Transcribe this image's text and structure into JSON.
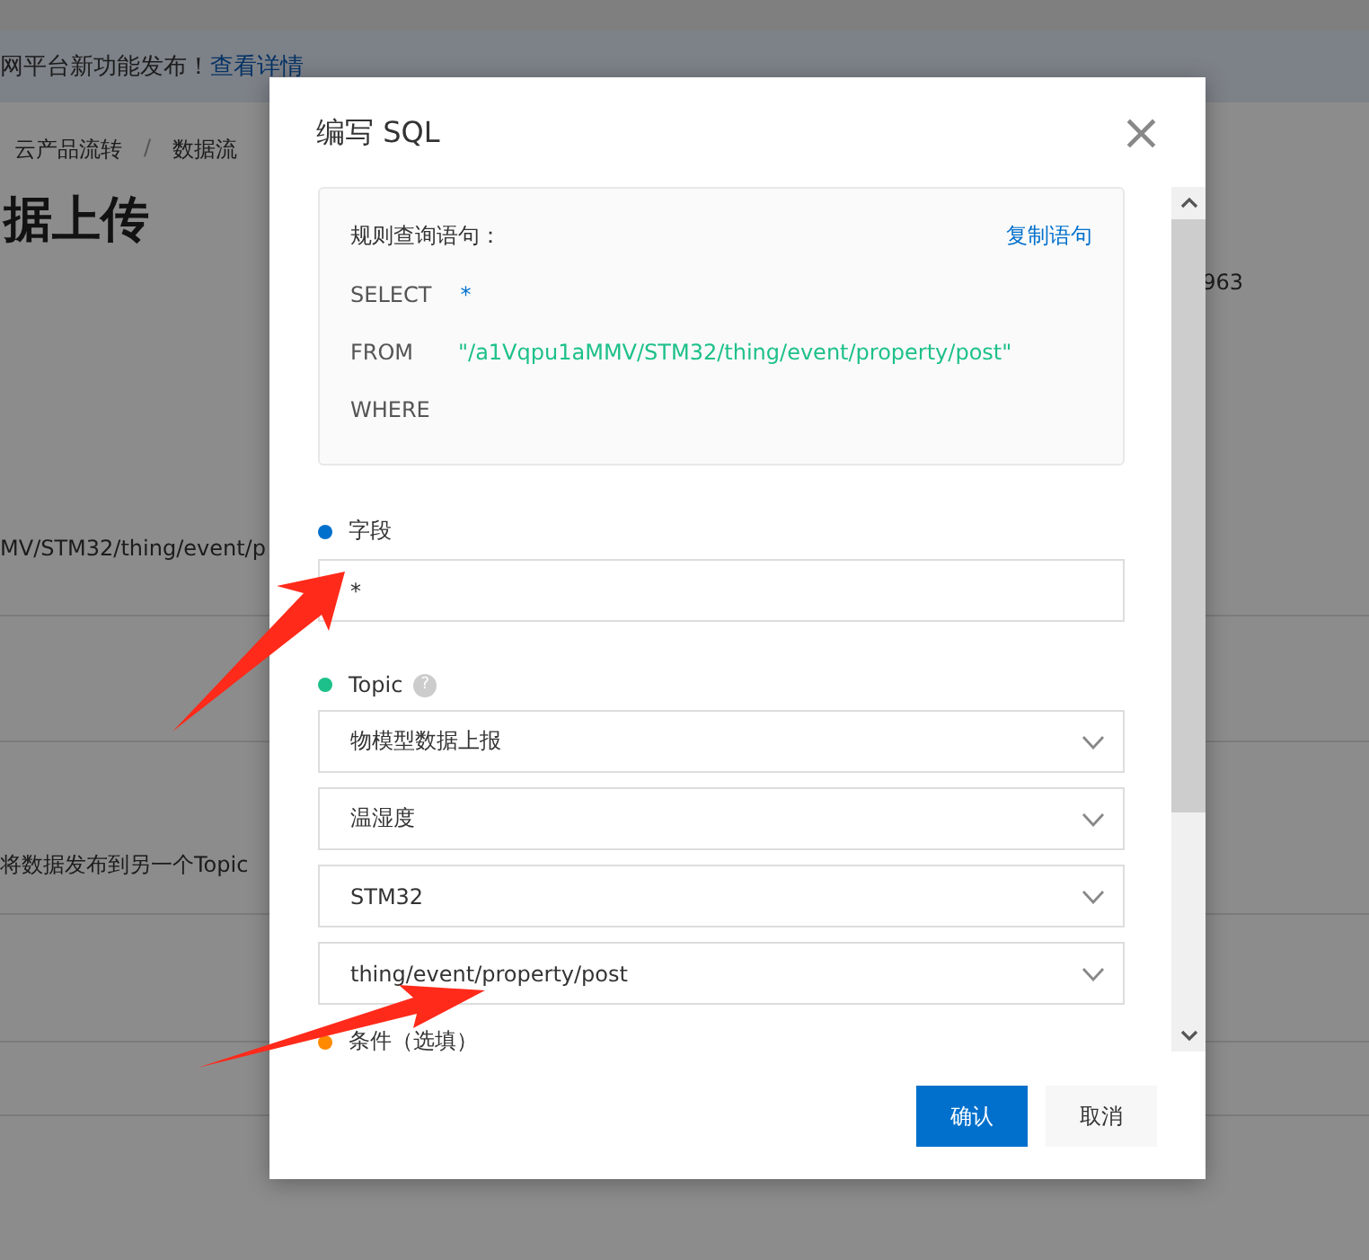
{
  "background_page": {
    "notice": {
      "text": "网平台新功能发布！",
      "link": "查看详情"
    },
    "breadcrumb": [
      "云产品流转",
      "数据流"
    ],
    "breadcrumb_separator": "/",
    "heading": "据上传",
    "side_value": "963",
    "topic_fragment": "MV/STM32/thing/event/p",
    "description": "将数据发布到另一个Topic"
  },
  "dialog": {
    "title": "编写 SQL",
    "close": "×",
    "query": {
      "label": "规则查询语句：",
      "copy_link": "复制语句",
      "lines": [
        {
          "keyword": "SELECT",
          "value": "*",
          "kind": "fields"
        },
        {
          "keyword": "FROM",
          "value": "\"/a1Vqpu1aMMV/STM32/thing/event/property/post\"",
          "kind": "topic"
        },
        {
          "keyword": "WHERE"
        }
      ]
    },
    "sections": [
      {
        "kind": "input",
        "label": "字段",
        "color": "#0070cc",
        "value": "*"
      },
      {
        "kind": "selects",
        "label": "Topic",
        "color": "#1dc08a",
        "help": "?",
        "options": [
          "物模型数据上报",
          "温湿度",
          "STM32",
          "thing/event/property/post"
        ]
      },
      {
        "kind": "heading",
        "label": "条件（选填）",
        "color": "#ff8a00"
      }
    ],
    "buttons": [
      {
        "label": "确认",
        "primary": true
      },
      {
        "label": "取消",
        "primary": false
      }
    ]
  }
}
